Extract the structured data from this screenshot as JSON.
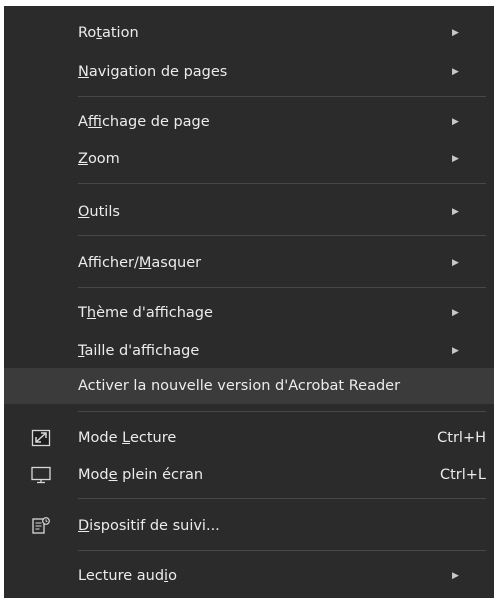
{
  "menu": {
    "items": {
      "rotation": {
        "label": "Rotation",
        "mnemonic": "t"
      },
      "page_navigation": {
        "label": "Navigation de pages",
        "mnemonic": "N"
      },
      "page_display": {
        "label": "Affichage de page",
        "mnemonic": "f"
      },
      "zoom": {
        "label": "Zoom",
        "mnemonic": "Z"
      },
      "tools": {
        "label": "Outils",
        "mnemonic": "O"
      },
      "show_hide": {
        "label": "Afficher/Masquer",
        "mnemonic": "M"
      },
      "display_theme": {
        "label": "Thème d'affichage",
        "mnemonic": "h"
      },
      "display_size": {
        "label": "Taille d'affichage",
        "mnemonic": "T"
      },
      "new_version": {
        "label": "Activer la nouvelle version d'Acrobat Reader"
      },
      "read_mode": {
        "label": "Mode Lecture",
        "mnemonic": "L",
        "shortcut": "Ctrl+H",
        "icon": "read-mode-icon"
      },
      "full_screen": {
        "label": "Mode plein écran",
        "mnemonic": "e",
        "shortcut": "Ctrl+L",
        "icon": "full-screen-icon"
      },
      "tracker": {
        "label": "Dispositif de suivi...",
        "mnemonic": "D",
        "icon": "tracker-icon"
      },
      "read_aloud": {
        "label": "Lecture audio",
        "mnemonic": "i"
      }
    },
    "submenu_arrow": "▶",
    "colors": {
      "background": "#2b2b2b",
      "highlight": "#3b3b3b",
      "text": "#ececec",
      "separator": "#474747"
    }
  }
}
